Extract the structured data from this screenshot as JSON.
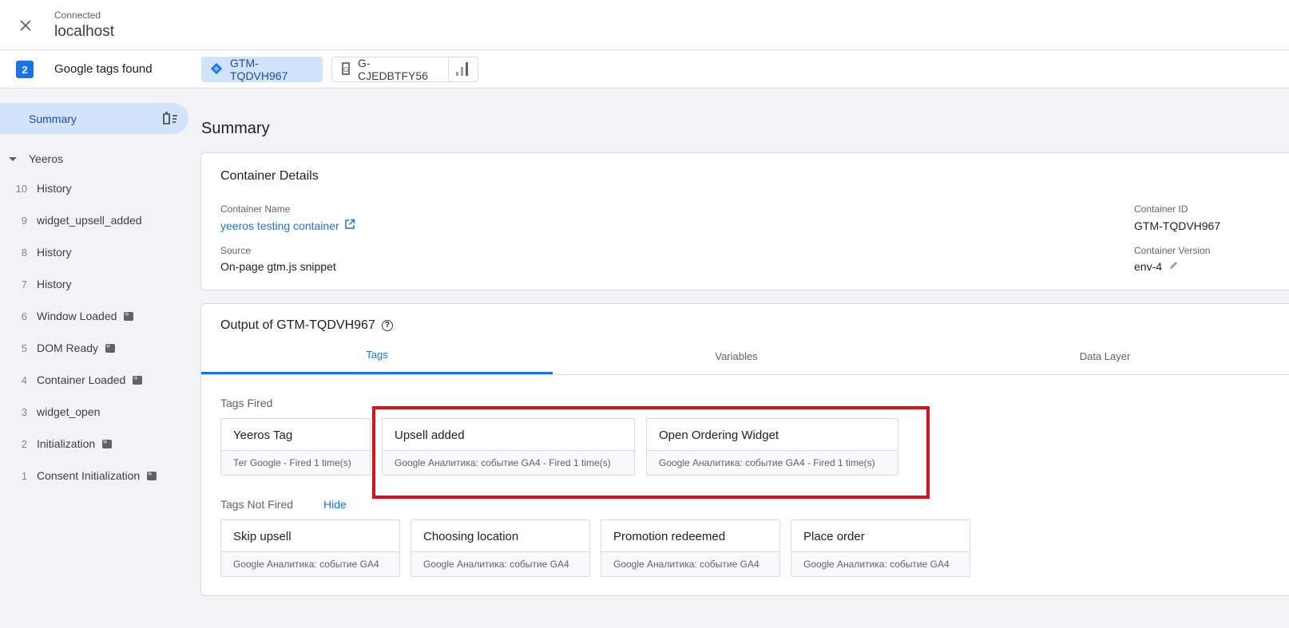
{
  "header": {
    "status": "Connected",
    "host": "localhost"
  },
  "tagbar": {
    "count": "2",
    "found_text": "Google tags found",
    "chips": [
      {
        "label": "GTM-TQDVH967",
        "icon": "gtm-diamond-icon",
        "selected": true
      },
      {
        "label": "G-CJEDBTFY56",
        "icon": "google-tag-icon",
        "selected": false
      }
    ]
  },
  "sidebar": {
    "summary_label": "Summary",
    "group_label": "Yeeros",
    "events": [
      {
        "num": "10",
        "label": "History",
        "api": false
      },
      {
        "num": "9",
        "label": "widget_upsell_added",
        "api": false
      },
      {
        "num": "8",
        "label": "History",
        "api": false
      },
      {
        "num": "7",
        "label": "History",
        "api": false
      },
      {
        "num": "6",
        "label": "Window Loaded",
        "api": true
      },
      {
        "num": "5",
        "label": "DOM Ready",
        "api": true
      },
      {
        "num": "4",
        "label": "Container Loaded",
        "api": true
      },
      {
        "num": "3",
        "label": "widget_open",
        "api": false
      },
      {
        "num": "2",
        "label": "Initialization",
        "api": true
      },
      {
        "num": "1",
        "label": "Consent Initialization",
        "api": true
      }
    ]
  },
  "main": {
    "title": "Summary",
    "container_details": {
      "title": "Container Details",
      "name_label": "Container Name",
      "name_value": "yeeros testing container",
      "source_label": "Source",
      "source_value": "On-page gtm.js snippet",
      "id_label": "Container ID",
      "id_value": "GTM-TQDVH967",
      "version_label": "Container Version",
      "version_value": "env-4"
    },
    "output": {
      "title": "Output of GTM-TQDVH967",
      "tabs": [
        "Tags",
        "Variables",
        "Data Layer"
      ],
      "fired_label": "Tags Fired",
      "fired": [
        {
          "name": "Yeeros Tag",
          "sub": "Тег Google - Fired 1 time(s)"
        },
        {
          "name": "Upsell added",
          "sub": "Google Аналитика: событие GA4 - Fired 1 time(s)"
        },
        {
          "name": "Open Ordering Widget",
          "sub": "Google Аналитика: событие GA4 - Fired 1 time(s)"
        }
      ],
      "not_fired_label": "Tags Not Fired",
      "hide_label": "Hide",
      "not_fired": [
        {
          "name": "Skip upsell",
          "sub": "Google Аналитика: событие GA4"
        },
        {
          "name": "Choosing location",
          "sub": "Google Аналитика: событие GA4"
        },
        {
          "name": "Promotion redeemed",
          "sub": "Google Аналитика: событие GA4"
        },
        {
          "name": "Place order",
          "sub": "Google Аналитика: событие GA4"
        }
      ]
    }
  },
  "colors": {
    "accent": "#1a73e8",
    "highlight": "#e0101a",
    "selected_bg": "#d2e3fc"
  }
}
